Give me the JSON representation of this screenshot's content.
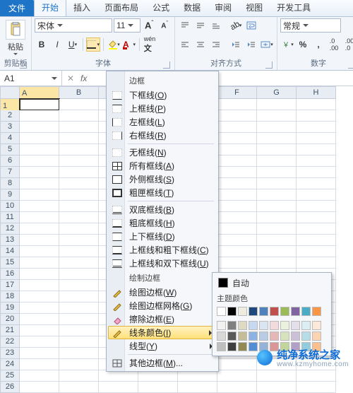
{
  "tabs": {
    "file": "文件",
    "items": [
      "开始",
      "插入",
      "页面布局",
      "公式",
      "数据",
      "审阅",
      "视图",
      "开发工具"
    ],
    "active": 0
  },
  "ribbon": {
    "clipboard": {
      "paste": "粘贴",
      "label": "剪贴板"
    },
    "font": {
      "name": "宋体",
      "size": "11",
      "label": "字体",
      "bold": "B",
      "italic": "I",
      "underline": "U"
    },
    "alignment": {
      "label": "对齐方式"
    },
    "number": {
      "format": "常规",
      "label": "数字"
    }
  },
  "namebox": "A1",
  "columns": [
    "A",
    "B",
    "C",
    "D",
    "E",
    "F",
    "G",
    "H"
  ],
  "rowcount": 26,
  "active_cell": {
    "row": 1,
    "col": 0
  },
  "menu": {
    "title1": "边框",
    "items1": [
      {
        "id": "bottom",
        "label": "下框线",
        "hotkey": "O"
      },
      {
        "id": "top",
        "label": "上框线",
        "hotkey": "P"
      },
      {
        "id": "left",
        "label": "左框线",
        "hotkey": "L"
      },
      {
        "id": "right",
        "label": "右框线",
        "hotkey": "R"
      }
    ],
    "items2": [
      {
        "id": "none",
        "label": "无框线",
        "hotkey": "N"
      },
      {
        "id": "all",
        "label": "所有框线",
        "hotkey": "A"
      },
      {
        "id": "outer",
        "label": "外侧框线",
        "hotkey": "S"
      },
      {
        "id": "thick",
        "label": "粗匣框线",
        "hotkey": "T"
      }
    ],
    "items3": [
      {
        "id": "dbb",
        "label": "双底框线",
        "hotkey": "B"
      },
      {
        "id": "tbb",
        "label": "粗底框线",
        "hotkey": "H"
      },
      {
        "id": "tb",
        "label": "上下框线",
        "hotkey": "D"
      },
      {
        "id": "tbth",
        "label": "上框线和粗下框线",
        "hotkey": "C"
      },
      {
        "id": "tbdb",
        "label": "上框线和双下框线",
        "hotkey": "U"
      }
    ],
    "title2": "绘制边框",
    "items4": [
      {
        "id": "draw",
        "icon": "pen",
        "label": "绘图边框",
        "hotkey": "W"
      },
      {
        "id": "drawgrid",
        "icon": "pen",
        "label": "绘图边框网格",
        "hotkey": "G"
      },
      {
        "id": "erase",
        "icon": "eraser",
        "label": "擦除边框",
        "hotkey": "E"
      },
      {
        "id": "linecolor",
        "icon": "pen",
        "label": "线条颜色",
        "hotkey": "I",
        "submenu": true,
        "hover": true
      },
      {
        "id": "linestyle",
        "label": "线型",
        "hotkey": "Y",
        "submenu": true
      },
      {
        "id": "more",
        "icon": "grid",
        "label": "其他边框",
        "hotkey": "M",
        "end": "..."
      }
    ]
  },
  "flyout": {
    "auto": "自动",
    "theme_label": "主题颜色",
    "theme_row1": [
      "#ffffff",
      "#000000",
      "#eeece1",
      "#1f497d",
      "#4f81bd",
      "#c0504d",
      "#9bbb59",
      "#8064a2",
      "#4bacc6",
      "#f79646"
    ],
    "theme_shades": [
      [
        "#f2f2f2",
        "#7f7f7f",
        "#ddd9c3",
        "#c6d9f0",
        "#dbe5f1",
        "#f2dbdb",
        "#eaf1dd",
        "#e5dfec",
        "#daeef3",
        "#fde9d9"
      ],
      [
        "#d8d8d8",
        "#595959",
        "#c4bd97",
        "#8db3e2",
        "#b8cce4",
        "#e5b8b7",
        "#d6e3bc",
        "#ccc0d9",
        "#b6dde8",
        "#fbd4b4"
      ],
      [
        "#bfbfbf",
        "#3f3f3f",
        "#938953",
        "#548dd4",
        "#95b3d7",
        "#d99795",
        "#c2d69b",
        "#b2a1c7",
        "#93cddd",
        "#fabf8f"
      ]
    ]
  },
  "watermark": {
    "title": "纯净系统之家",
    "url": "www.kzmyhome.com"
  }
}
